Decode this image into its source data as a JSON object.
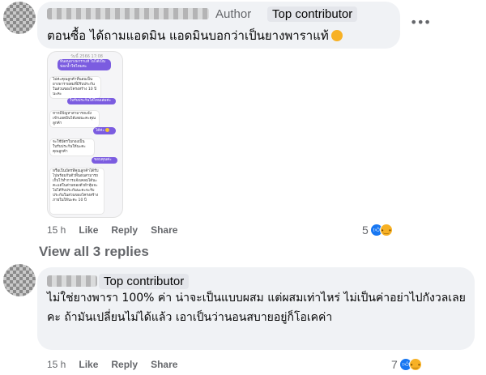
{
  "comment1": {
    "author_badge": "Author",
    "contributor_badge": "Top contributor",
    "text": "ตอนซื้อ ได้ถามแอดมิน แอดมินบอกว่าเป็นยางพาราแท้",
    "more_icon": "more-horizontal-icon",
    "attachment": {
      "timestamp": "วันนี้ 2566 17:08",
      "messages": [
        {
          "from": "me",
          "text": "ที่นอนยางพาราแท้ ไม่ได้เป็นฟองน้ำใช่ไหมคะ"
        },
        {
          "from": "them",
          "text": "ไม่ค่ะคุณลูกค้าที่นอนเป็นยางพาราผสมที่มีรับประกันในส่วนของโครงสร้าง 10 ปีนะคะ"
        },
        {
          "from": "me",
          "text": "ใบรับประกันได้ไหมเล่มค่ะ"
        },
        {
          "from": "them",
          "text": "หากมีปัญหาสามารถแจ้งเข้าแอดมินได้เลยนะคะคุณลูกค้า"
        },
        {
          "from": "me",
          "text": "ได้ค่ะ"
        },
        {
          "from": "them",
          "text": "จะใช้บัตรใบกองเป็นใบรับประกันให้นะคะคุณลูกค้า"
        },
        {
          "from": "me",
          "text": "ขอบคุณค่ะ"
        },
        {
          "from": "them",
          "text": "หรือเป็นบัตรที่คุณลูกค้าได้รับไปพร้อมกับตัวที่นอนสามารถเก็บไว้ทำการแจ้งเคลมได้นะคะแต่ในส่วนของตัวผ้าหุ้มจะไม่ได้รับประกันนะคะจะรับประกันในส่วนของโครงสร้างภายในให้นะคะ 10 ปี"
        }
      ]
    },
    "actions": {
      "time": "15 h",
      "like": "Like",
      "reply": "Reply",
      "share": "Share"
    },
    "reactions": {
      "count": "5",
      "icons": [
        "like-icon",
        "sad-icon"
      ]
    }
  },
  "view_replies": "View all 3 replies",
  "comment2": {
    "contributor_badge": "Top contributor",
    "text": "ไม่ใช่ยางพารา 100% ค่า น่าจะเป็นแบบผสม แต่ผสมเท่าไหร่ ไม่เป็นค่าอย่าไปกังวลเลยคะ ถ้ามันเปลี่ยนไม่ได้แล้ว เอาเป็นว่านอนสบายอยู่ก็โอเคค่า",
    "actions": {
      "time": "15 h",
      "like": "Like",
      "reply": "Reply",
      "share": "Share"
    },
    "reactions": {
      "count": "7",
      "icons": [
        "like-icon",
        "sad-icon"
      ]
    }
  },
  "colors": {
    "bubble": "#f0f2f5",
    "muted": "#65676b",
    "like_blue": "#1877f2",
    "chat_purple": "#7b5ce0"
  }
}
